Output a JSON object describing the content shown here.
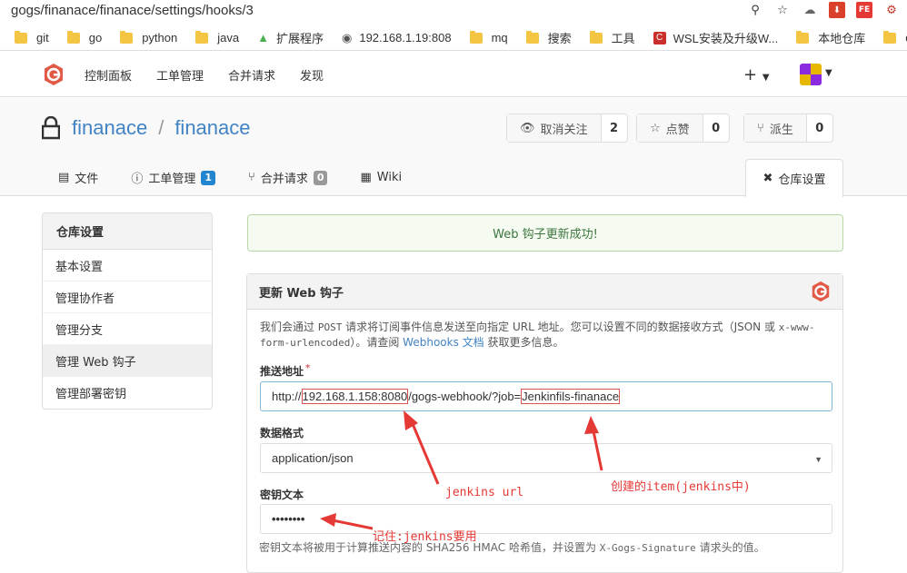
{
  "browser": {
    "url": "gogs/finanace/finanace/settings/hooks/3",
    "bookmarks": [
      "git",
      "go",
      "python",
      "java",
      "扩展程序",
      "192.168.1.19:808",
      "mq",
      "搜索",
      "工具",
      "WSL安装及升级W...",
      "本地仓库",
      "docker"
    ]
  },
  "nav": {
    "items": [
      "控制面板",
      "工单管理",
      "合并请求",
      "发现"
    ],
    "plus": "+"
  },
  "repo": {
    "owner": "finanace",
    "separator": "/",
    "name": "finanace",
    "watch_label": "取消关注",
    "watch_count": "2",
    "star_label": "点赞",
    "star_count": "0",
    "fork_label": "派生",
    "fork_count": "0"
  },
  "tabs": {
    "files": "文件",
    "issues": "工单管理",
    "issues_count": "1",
    "pulls": "合并请求",
    "pulls_count": "0",
    "wiki": "Wiki",
    "settings": "仓库设置"
  },
  "sidebar": {
    "header": "仓库设置",
    "items": [
      "基本设置",
      "管理协作者",
      "管理分支",
      "管理 Web 钩子",
      "管理部署密钥"
    ]
  },
  "flash": {
    "message": "Web 钩子更新成功!"
  },
  "form": {
    "title": "更新 Web 钩子",
    "desc_1": "我们会通过 ",
    "desc_post": "POST",
    "desc_2": " 请求将订阅事件信息发送至向指定 URL 地址。您可以设置不同的数据接收方式（JSON 或 ",
    "desc_xwww": "x-www-form-urlencoded",
    "desc_3": "）。请查阅 ",
    "desc_link": "Webhooks 文档",
    "desc_4": " 获取更多信息。",
    "url_label": "推送地址",
    "url_req": "*",
    "url_prefix": "http://",
    "url_host": "192.168.1.158:8080",
    "url_mid": "/gogs-webhook/?job=",
    "url_job": "Jenkinfils-finanace",
    "content_type_label": "数据格式",
    "content_type_value": "application/json",
    "secret_label": "密钥文本",
    "secret_value": "••••••••",
    "hint_1": "密钥文本将被用于计算推送内容的 SHA256 HMAC 哈希值，并设置为 ",
    "hint_code": "X-Gogs-Signature",
    "hint_2": " 请求头的值。"
  },
  "annotations": {
    "jenkins_url": "jenkins url",
    "created_item": "创建的item(jenkins中)",
    "remember": "记住:jenkins要用"
  },
  "colors": {
    "annotation": "#e53935",
    "link": "#4183c4",
    "gogs": "#e05a47"
  }
}
